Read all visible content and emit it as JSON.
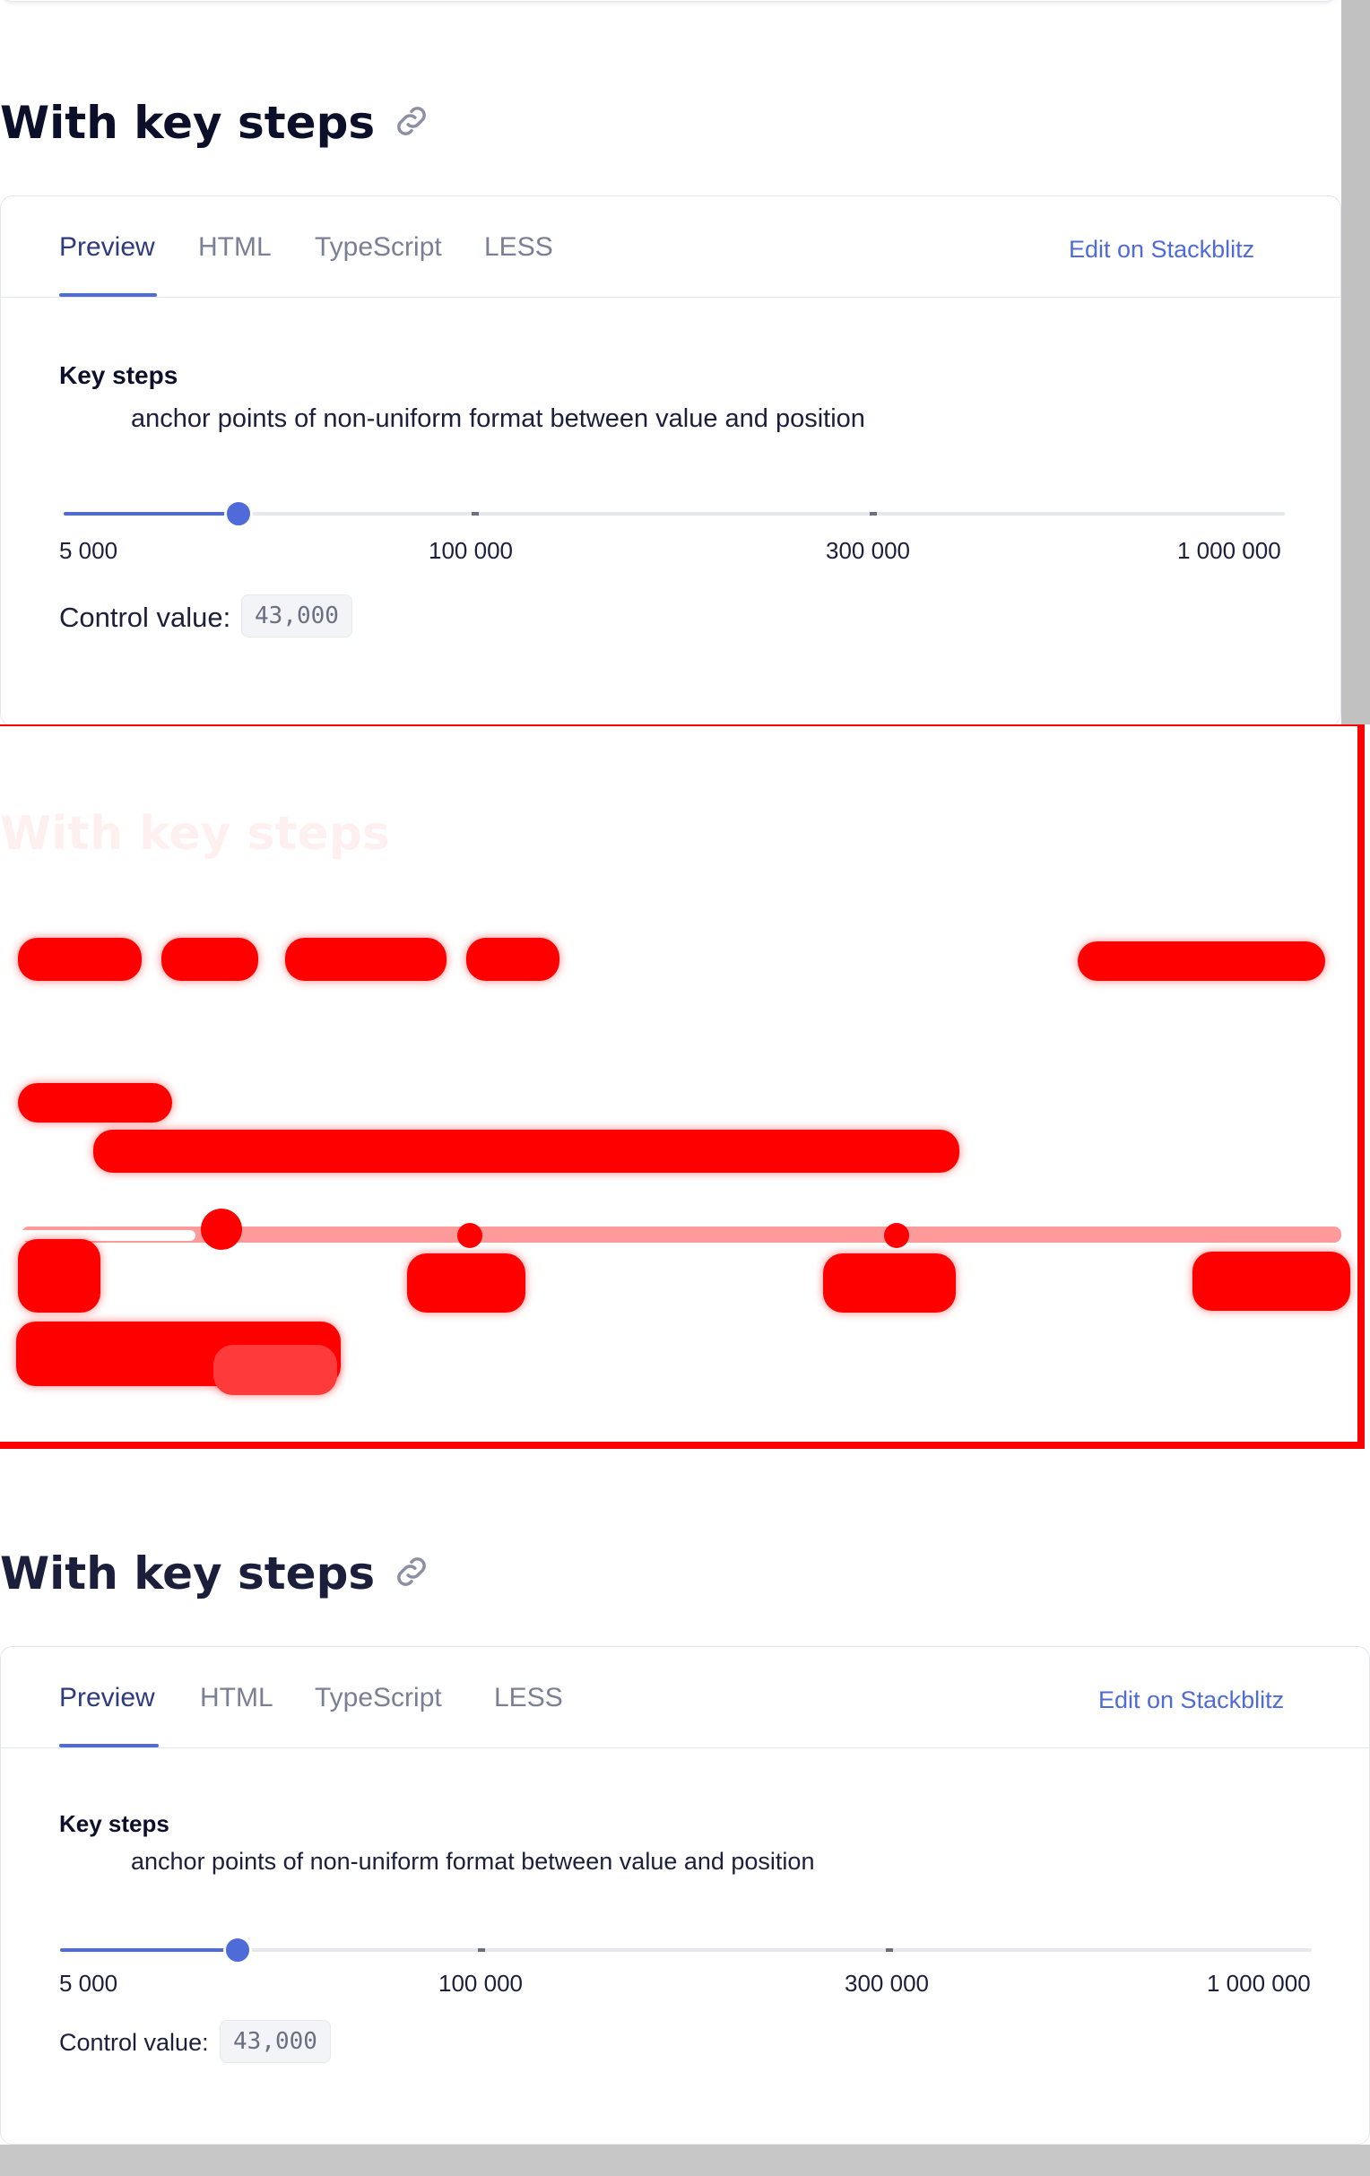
{
  "sections": [
    {
      "title": "With key steps",
      "tabs": [
        "Preview",
        "HTML",
        "TypeScript",
        "LESS"
      ],
      "active_tab": "Preview",
      "stackblitz_label": "Edit on Stackblitz",
      "description_title": "Key steps",
      "description": "anchor points of non-uniform format between value and position",
      "slider": {
        "tick_labels": [
          "5 000",
          "100 000",
          "300 000",
          "1 000 000"
        ],
        "fill_fraction": 0.145
      },
      "control_value_label": "Control value:",
      "control_value": "43,000"
    },
    {
      "title": "With key steps",
      "tabs": [
        "Preview",
        "HTML",
        "TypeScript",
        "LESS"
      ],
      "active_tab": "Preview",
      "stackblitz_label": "Edit on Stackblitz",
      "description_title": "Key steps",
      "description": "anchor points of non-uniform format between value and position",
      "slider": {
        "tick_labels": [
          "5 000",
          "100 000",
          "300 000",
          "1 000 000"
        ],
        "fill_fraction": 0.145
      },
      "control_value_label": "Control value:",
      "control_value": "43,000"
    }
  ],
  "overlay": {
    "ghost_title": "With key steps",
    "accent": "#ff0000"
  },
  "colors": {
    "accent": "#4f6bd9",
    "title": "#0b0f2a",
    "muted": "#7a7f95",
    "border": "#e4e6ef"
  }
}
